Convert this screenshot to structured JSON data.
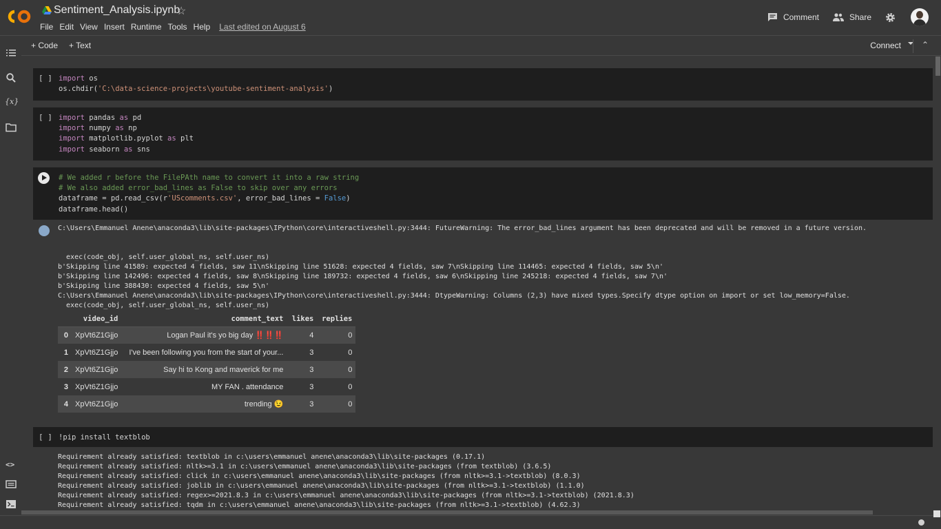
{
  "header": {
    "title": "Sentiment_Analysis.ipynb",
    "menu": [
      "File",
      "Edit",
      "View",
      "Insert",
      "Runtime",
      "Tools",
      "Help"
    ],
    "last_edited": "Last edited on August 6",
    "comment_label": "Comment",
    "share_label": "Share"
  },
  "toolbar": {
    "code_label": "+ Code",
    "text_label": "+ Text",
    "connect_label": "Connect"
  },
  "cells": [
    {
      "run_label": "[ ]",
      "lines": [
        [
          {
            "t": "import",
            "c": "kw"
          },
          {
            "t": " os",
            "c": ""
          }
        ],
        [
          {
            "t": "os.chdir(",
            "c": ""
          },
          {
            "t": "'C:\\data-science-projects\\youtube-sentiment-analysis'",
            "c": "str"
          },
          {
            "t": ")",
            "c": ""
          }
        ]
      ]
    },
    {
      "run_label": "[ ]",
      "lines": [
        [
          {
            "t": "import",
            "c": "kw"
          },
          {
            "t": " pandas ",
            "c": ""
          },
          {
            "t": "as",
            "c": "kw"
          },
          {
            "t": " pd",
            "c": ""
          }
        ],
        [
          {
            "t": "import",
            "c": "kw"
          },
          {
            "t": " numpy ",
            "c": ""
          },
          {
            "t": "as",
            "c": "kw"
          },
          {
            "t": " np",
            "c": ""
          }
        ],
        [
          {
            "t": "import",
            "c": "kw"
          },
          {
            "t": " matplotlib.pyplot ",
            "c": ""
          },
          {
            "t": "as",
            "c": "kw"
          },
          {
            "t": " plt",
            "c": ""
          }
        ],
        [
          {
            "t": "import",
            "c": "kw"
          },
          {
            "t": " seaborn ",
            "c": ""
          },
          {
            "t": "as",
            "c": "kw"
          },
          {
            "t": " sns",
            "c": ""
          }
        ]
      ]
    },
    {
      "run_label": "",
      "lines": [
        [
          {
            "t": "# We added r before the FilePAth name to convert it into a raw string",
            "c": "cm"
          }
        ],
        [
          {
            "t": "# We also added error_bad_lines as False to skip over any errors",
            "c": "cm"
          }
        ],
        [
          {
            "t": "dataframe = pd.read_csv(r",
            "c": ""
          },
          {
            "t": "'UScomments.csv'",
            "c": "str"
          },
          {
            "t": ", error_bad_lines = ",
            "c": ""
          },
          {
            "t": "False",
            "c": "bool"
          },
          {
            "t": ")",
            "c": ""
          }
        ],
        [
          {
            "t": "dataframe.head()",
            "c": ""
          }
        ]
      ]
    },
    {
      "run_label": "[ ]",
      "lines": [
        [
          {
            "t": "!pip install textblob",
            "c": ""
          }
        ]
      ]
    }
  ],
  "output1": [
    "C:\\Users\\Emmanuel Anene\\anaconda3\\lib\\site-packages\\IPython\\core\\interactiveshell.py:3444: FutureWarning: The error_bad_lines argument has been deprecated and will be removed in a future version.",
    "",
    "",
    "  exec(code_obj, self.user_global_ns, self.user_ns)",
    "b'Skipping line 41589: expected 4 fields, saw 11\\nSkipping line 51628: expected 4 fields, saw 7\\nSkipping line 114465: expected 4 fields, saw 5\\n'",
    "b'Skipping line 142496: expected 4 fields, saw 8\\nSkipping line 189732: expected 4 fields, saw 6\\nSkipping line 245218: expected 4 fields, saw 7\\n'",
    "b'Skipping line 388430: expected 4 fields, saw 5\\n'",
    "C:\\Users\\Emmanuel Anene\\anaconda3\\lib\\site-packages\\IPython\\core\\interactiveshell.py:3444: DtypeWarning: Columns (2,3) have mixed types.Specify dtype option on import or set low_memory=False.",
    "  exec(code_obj, self.user_global_ns, self.user_ns)"
  ],
  "dataframe": {
    "columns": [
      "",
      "video_id",
      "comment_text",
      "likes",
      "replies"
    ],
    "rows": [
      [
        "0",
        "XpVt6Z1Gjjo",
        "Logan Paul it's yo big day ‼️‼️‼️",
        "4",
        "0"
      ],
      [
        "1",
        "XpVt6Z1Gjjo",
        "I've been following you from the start of your...",
        "3",
        "0"
      ],
      [
        "2",
        "XpVt6Z1Gjjo",
        "Say hi to Kong and maverick for me",
        "3",
        "0"
      ],
      [
        "3",
        "XpVt6Z1Gjjo",
        "MY FAN . attendance",
        "3",
        "0"
      ],
      [
        "4",
        "XpVt6Z1Gjjo",
        "trending 😉",
        "3",
        "0"
      ]
    ]
  },
  "output2": [
    "Requirement already satisfied: textblob in c:\\users\\emmanuel anene\\anaconda3\\lib\\site-packages (0.17.1)",
    "Requirement already satisfied: nltk>=3.1 in c:\\users\\emmanuel anene\\anaconda3\\lib\\site-packages (from textblob) (3.6.5)",
    "Requirement already satisfied: click in c:\\users\\emmanuel anene\\anaconda3\\lib\\site-packages (from nltk>=3.1->textblob) (8.0.3)",
    "Requirement already satisfied: joblib in c:\\users\\emmanuel anene\\anaconda3\\lib\\site-packages (from nltk>=3.1->textblob) (1.1.0)",
    "Requirement already satisfied: regex>=2021.8.3 in c:\\users\\emmanuel anene\\anaconda3\\lib\\site-packages (from nltk>=3.1->textblob) (2021.8.3)",
    "Requirement already satisfied: tqdm in c:\\users\\emmanuel anene\\anaconda3\\lib\\site-packages (from nltk>=3.1->textblob) (4.62.3)"
  ],
  "icons": {
    "logo": "colab-logo-icon",
    "drive": "google-drive-icon",
    "star": "star-icon",
    "comment": "comment-icon",
    "share": "share-icon",
    "settings": "gear-icon"
  },
  "colors": {
    "background": "#383838",
    "cell_background": "#1e1e1e",
    "logo_orange": "#F9AB00",
    "logo_dark_orange": "#E8710A"
  }
}
